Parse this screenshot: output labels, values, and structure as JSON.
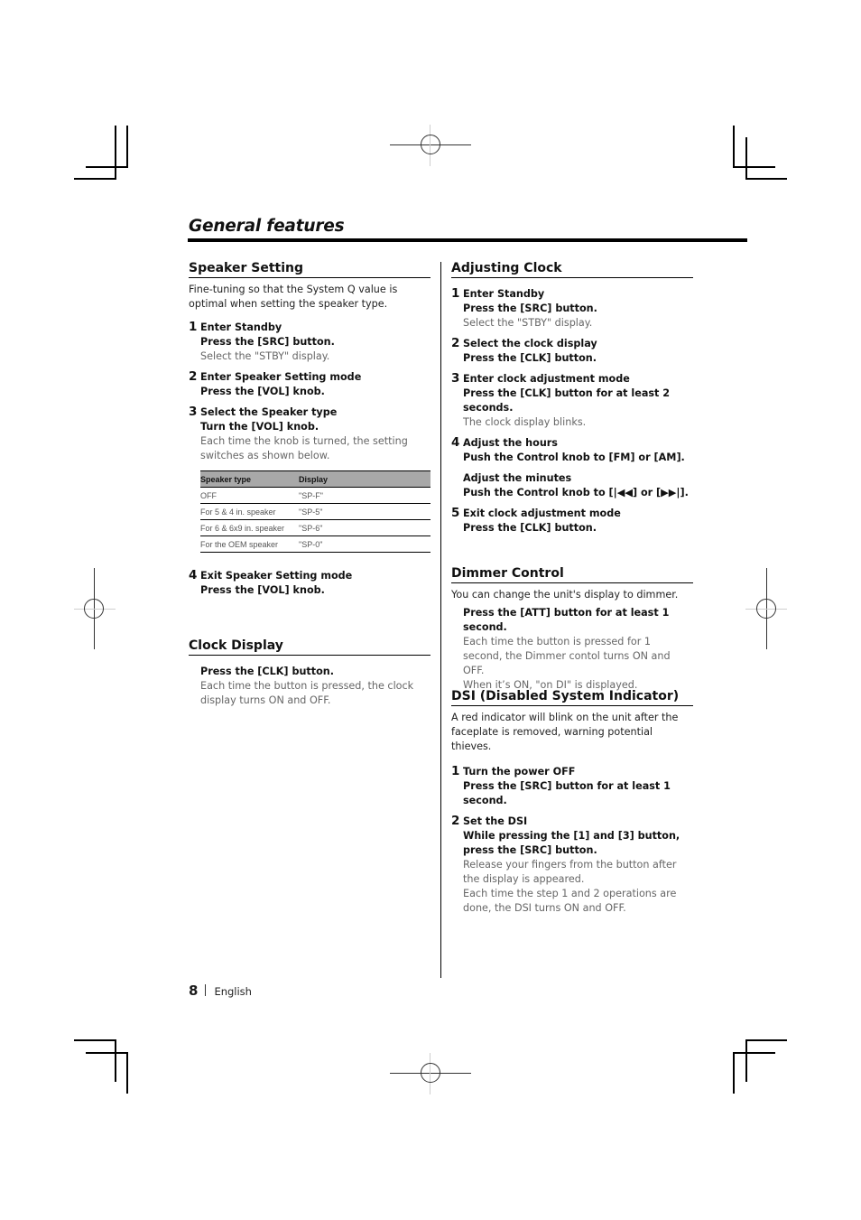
{
  "page": {
    "title": "General features",
    "page_number": "8",
    "language": "English"
  },
  "speaker_setting": {
    "heading": "Speaker Setting",
    "intro": "Fine-tuning so that the System Q value is optimal when setting the speaker type.",
    "steps": [
      {
        "num": "1",
        "title": "Enter Standby",
        "action": "Press the [SRC] button.",
        "note": "Select the \"STBY\" display."
      },
      {
        "num": "2",
        "title": "Enter Speaker Setting mode",
        "action": "Press the [VOL] knob.",
        "note": ""
      },
      {
        "num": "3",
        "title": "Select the Speaker type",
        "action": "Turn the [VOL] knob.",
        "note": "Each time the knob is turned, the setting switches as shown below."
      },
      {
        "num": "4",
        "title": "Exit Speaker Setting mode",
        "action": "Press the [VOL] knob.",
        "note": ""
      }
    ],
    "table": {
      "headers": [
        "Speaker type",
        "Display"
      ],
      "rows": [
        [
          "OFF",
          "\"SP-F\""
        ],
        [
          "For 5 & 4 in. speaker",
          "\"SP-5\""
        ],
        [
          "For 6 & 6x9 in. speaker",
          "\"SP-6\""
        ],
        [
          "For the OEM speaker",
          "\"SP-0\""
        ]
      ]
    }
  },
  "clock_display": {
    "heading": "Clock Display",
    "action": "Press the [CLK] button.",
    "note": "Each time the button is pressed, the clock display turns ON and OFF."
  },
  "adjusting_clock": {
    "heading": "Adjusting Clock",
    "steps": [
      {
        "num": "1",
        "title": "Enter Standby",
        "action": "Press the [SRC] button.",
        "note": "Select the \"STBY\" display."
      },
      {
        "num": "2",
        "title": "Select the clock display",
        "action": "Press the [CLK] button.",
        "note": ""
      },
      {
        "num": "3",
        "title": "Enter clock adjustment mode",
        "action": "Press the [CLK] button for at least 2 seconds.",
        "note": "The clock display blinks."
      },
      {
        "num": "4",
        "title": "Adjust the hours",
        "action": "Push the Control knob to [FM] or [AM].",
        "note": ""
      },
      {
        "num": "5",
        "title": "Exit clock adjustment mode",
        "action": "Press the [CLK] button.",
        "note": ""
      }
    ],
    "minutes": {
      "title": "Adjust the minutes",
      "action": "Push the Control knob to [|◀◀] or [▶▶|]."
    }
  },
  "dimmer_control": {
    "heading": "Dimmer Control",
    "intro": "You can change the unit's display to dimmer.",
    "action": "Press the [ATT] button for at least 1 second.",
    "note1": "Each time the button is pressed for 1 second, the Dimmer contol turns ON and OFF.",
    "note2": "When it’s ON, \"on DI\" is displayed."
  },
  "dsi": {
    "heading": "DSI (Disabled System Indicator)",
    "intro": "A red indicator will blink on the unit after the faceplate is removed, warning potential thieves.",
    "steps": [
      {
        "num": "1",
        "title": "Turn the power OFF",
        "action": "Press the [SRC] button for at least 1 second.",
        "note1": "",
        "note2": ""
      },
      {
        "num": "2",
        "title": "Set the DSI",
        "action": "While pressing the [1] and [3] button, press the [SRC] button.",
        "note1": "Release your fingers from the button after the display is appeared.",
        "note2": "Each time the step 1 and 2 operations are done, the DSI turns ON and OFF."
      }
    ]
  }
}
